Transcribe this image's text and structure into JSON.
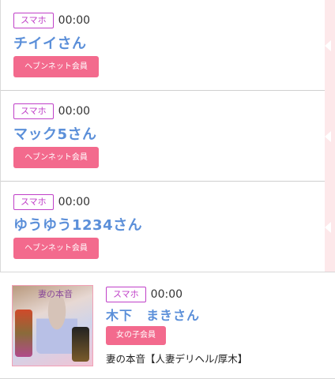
{
  "entries": [
    {
      "device": "スマホ",
      "time": "00:00",
      "name": "チイイさん",
      "member_type": "ヘブンネット会員"
    },
    {
      "device": "スマホ",
      "time": "00:00",
      "name": "マック5さん",
      "member_type": "ヘブンネット会員"
    },
    {
      "device": "スマホ",
      "time": "00:00",
      "name": "ゆうゆう1234さん",
      "member_type": "ヘブンネット会員"
    }
  ],
  "girl_entry": {
    "device": "スマホ",
    "time": "00:00",
    "name": "木下　まきさん",
    "member_type": "女の子会員",
    "shop": "妻の本音【人妻デリヘル/厚木】",
    "thumbnail_logo": "妻の本音"
  },
  "colors": {
    "name_blue": "#5b8fd9",
    "badge_pink": "#f36a8d",
    "device_purple": "#c040c8",
    "rail_pink": "#fde8ea"
  }
}
